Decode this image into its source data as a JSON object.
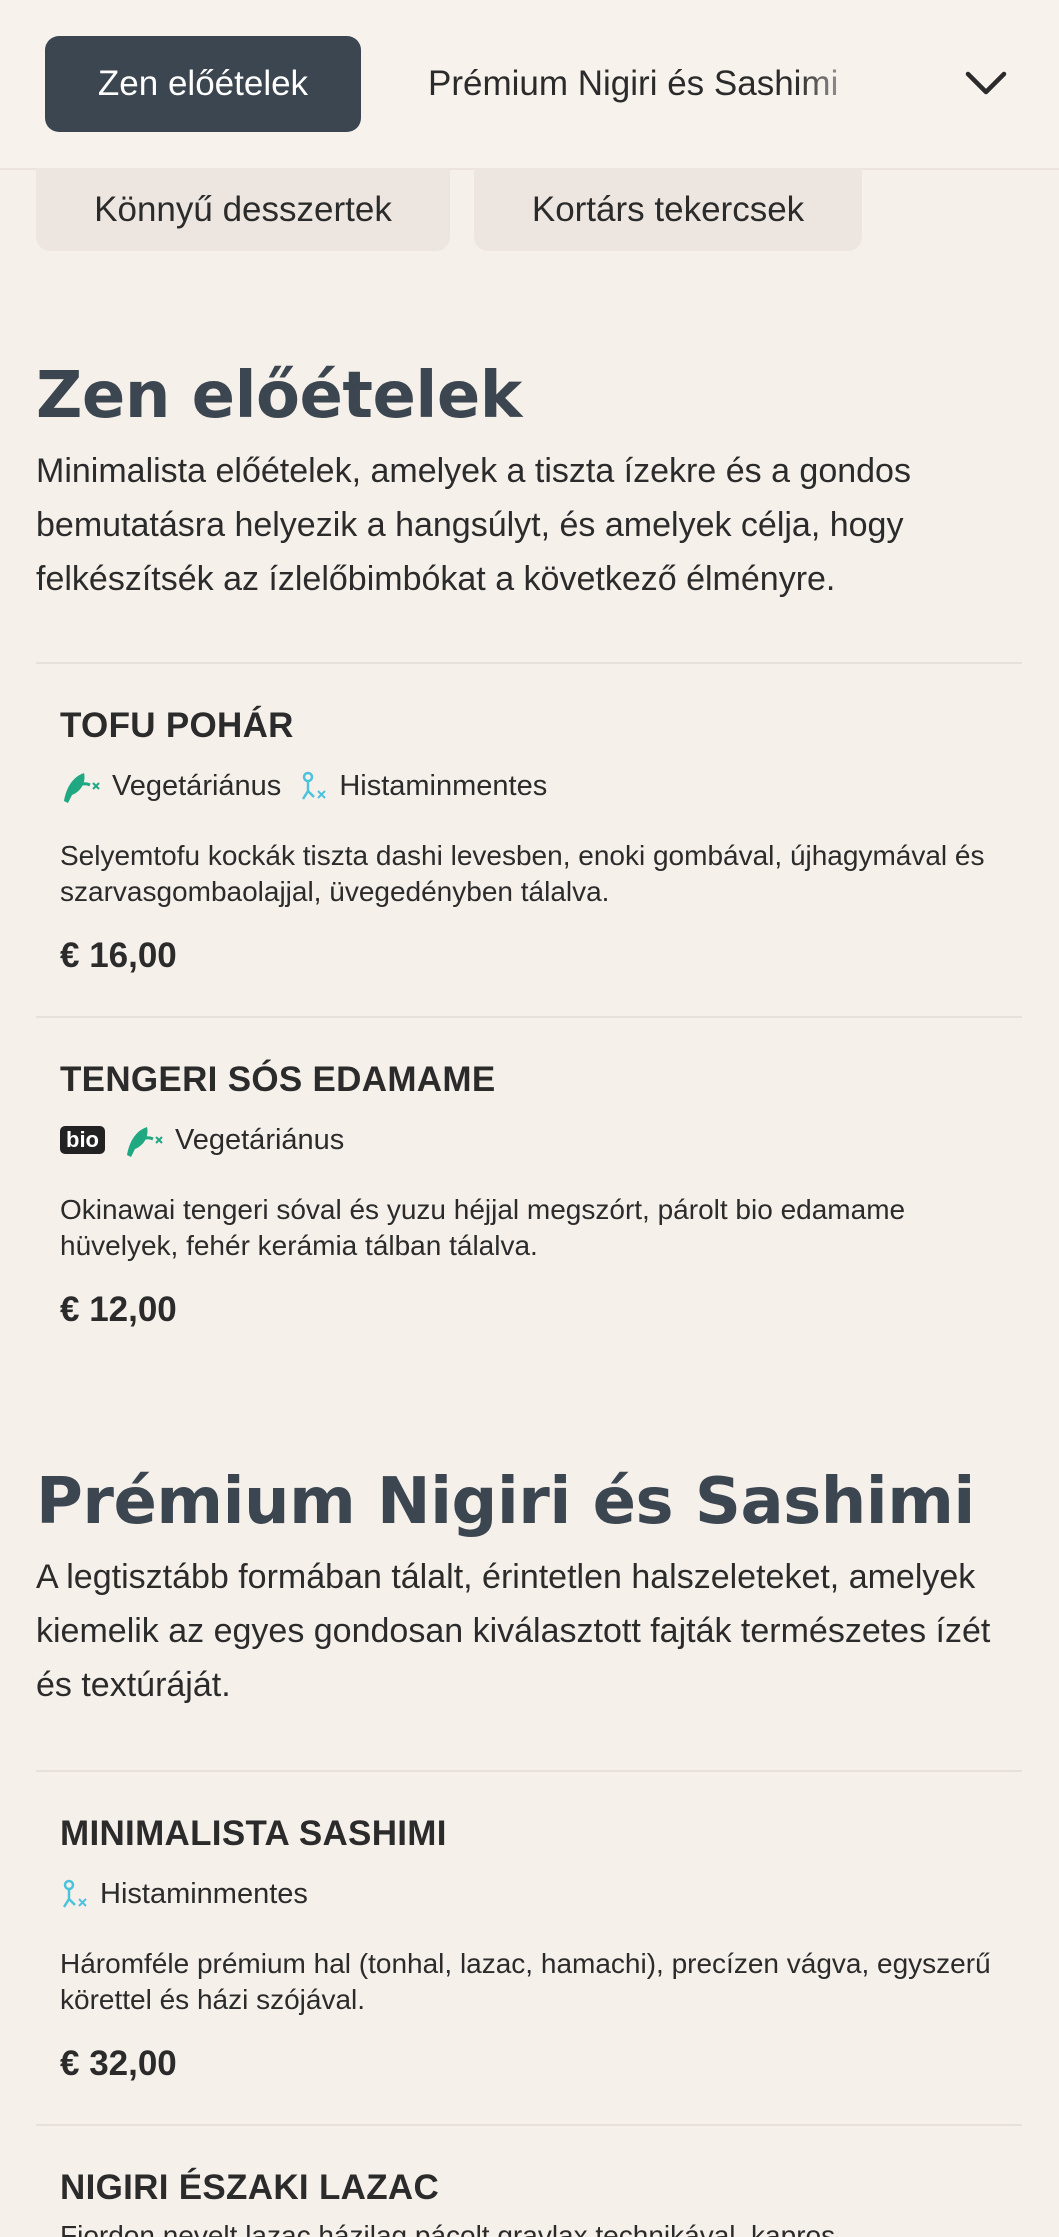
{
  "nav": {
    "active_tab": "Zen előételek",
    "next_tab": "Prémium Nigiri és Sashimi",
    "row2": [
      "Könnyű desszertek",
      "Kortárs tekercsek"
    ]
  },
  "sections": [
    {
      "title": "Zen előételek",
      "description": "Minimalista előételek, amelyek a tiszta ízekre és a gondos bemutatásra helyezik a hangsúlyt, és amelyek célja, hogy felkészítsék az ízlelőbimbókat a következő élményre.",
      "items": [
        {
          "name": "TOFU POHÁR",
          "tags": [
            "Vegetáriánus",
            "Histaminmentes"
          ],
          "description": "Selyemtofu kockák tiszta dashi levesben, enoki gombával, újhagymával és szarvasgombaolajjal, üvegedényben tálalva.",
          "price": "€ 16,00"
        },
        {
          "name": "TENGERI SÓS EDAMAME",
          "badge": "bio",
          "tags": [
            "Vegetáriánus"
          ],
          "description": "Okinawai tengeri sóval és yuzu héjjal megszórt, párolt bio edamame hüvelyek, fehér kerámia tálban tálalva.",
          "price": "€ 12,00"
        }
      ]
    },
    {
      "title": "Prémium Nigiri és Sashimi",
      "description": "A legtisztább formában tálalt, érintetlen halszeleteket, amelyek kiemelik az egyes gondosan kiválasztott fajták természetes ízét és textúráját.",
      "items": [
        {
          "name": "MINIMALISTA SASHIMI",
          "tags": [
            "Histaminmentes"
          ],
          "description": "Háromféle prémium hal (tonhal, lazac, hamachi), precízen vágva, egyszerű körettel és házi szójával.",
          "price": "€ 32,00"
        },
        {
          "name": "NIGIRI ÉSZAKI LAZAC",
          "description": "Fjordon nevelt lazac házilag pácolt gravlax technikával, kapros"
        }
      ]
    }
  ],
  "colors": {
    "background": "#f6f0eb",
    "active_tab": "#3c4650",
    "heading": "#3c4650",
    "vegetarian_icon": "#1fa882",
    "histamine_icon": "#4cc3dc"
  },
  "icons": {
    "dropdown": "chevron-down-icon",
    "vegetarian": "leaf-vegetarian-icon",
    "histamine_free": "histamine-free-icon"
  }
}
